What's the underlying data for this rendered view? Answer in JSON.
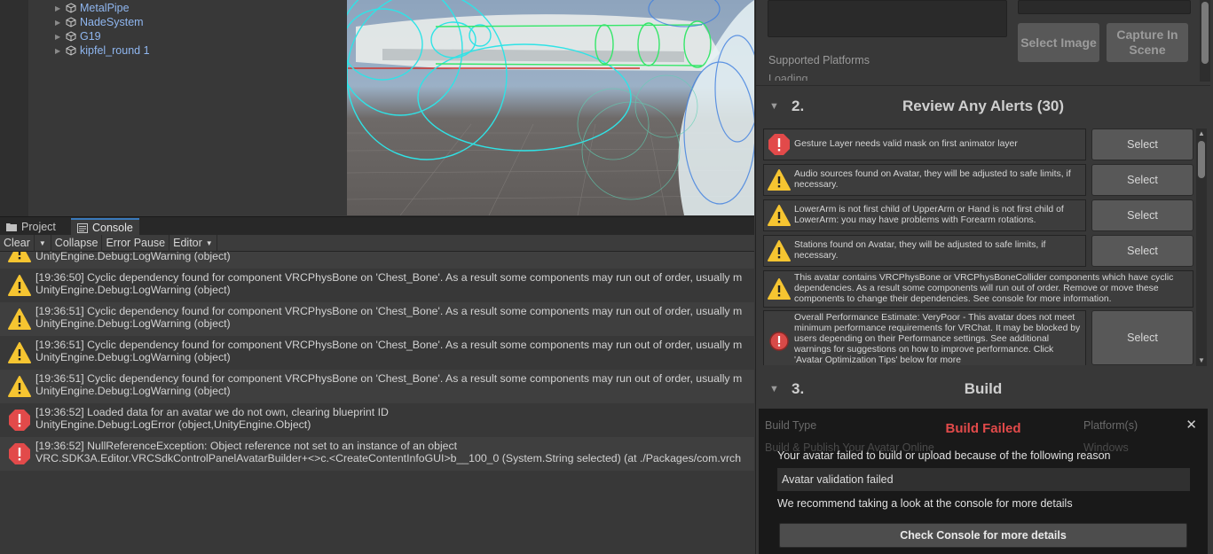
{
  "hierarchy": {
    "items": [
      {
        "label": "MetalPipe"
      },
      {
        "label": "NadeSystem"
      },
      {
        "label": "G19"
      },
      {
        "label": "kipfel_round 1"
      }
    ]
  },
  "console": {
    "tabs": [
      {
        "label": "Project",
        "icon": "folder-icon"
      },
      {
        "label": "Console",
        "icon": "console-icon"
      }
    ],
    "toolbar": {
      "clear": "Clear",
      "collapse": "Collapse",
      "error_pause": "Error Pause",
      "editor": "Editor"
    },
    "logs": [
      {
        "level": "warning",
        "line1": "UnityEngine.Debug:LogWarning (object)",
        "line2": ""
      },
      {
        "level": "warning",
        "line1": "[19:36:50] Cyclic dependency found for component VRCPhysBone on 'Chest_Bone'.  As a result some components may run out of order, usually m",
        "line2": "UnityEngine.Debug:LogWarning (object)"
      },
      {
        "level": "warning",
        "line1": "[19:36:51] Cyclic dependency found for component VRCPhysBone on 'Chest_Bone'.  As a result some components may run out of order, usually m",
        "line2": "UnityEngine.Debug:LogWarning (object)"
      },
      {
        "level": "warning",
        "line1": "[19:36:51] Cyclic dependency found for component VRCPhysBone on 'Chest_Bone'.  As a result some components may run out of order, usually m",
        "line2": "UnityEngine.Debug:LogWarning (object)"
      },
      {
        "level": "warning",
        "line1": "[19:36:51] Cyclic dependency found for component VRCPhysBone on 'Chest_Bone'.  As a result some components may run out of order, usually m",
        "line2": "UnityEngine.Debug:LogWarning (object)"
      },
      {
        "level": "error",
        "line1": "[19:36:52] Loaded data for an avatar we do not own, clearing blueprint ID",
        "line2": "UnityEngine.Debug:LogError (object,UnityEngine.Object)"
      },
      {
        "level": "error",
        "line1": "[19:36:52] NullReferenceException: Object reference not set to an instance of an object",
        "line2": "VRC.SDK3A.Editor.VRCSdkControlPanelAvatarBuilder+<>c.<CreateContentInfoGUI>b__100_0 (System.String selected) (at ./Packages/com.vrch"
      }
    ]
  },
  "sdk": {
    "select_image": "Select Image",
    "capture_in_scene": "Capture In Scene",
    "supported_platforms": "Supported Platforms",
    "loading": "Loading...",
    "section2": {
      "num": "2.",
      "title": "Review Any Alerts (30)"
    },
    "alerts": [
      {
        "level": "error",
        "message": "Gesture Layer needs valid mask on first animator layer",
        "select": "Select"
      },
      {
        "level": "warning",
        "message": "Audio sources found on Avatar, they will be adjusted to safe limits, if necessary.",
        "select": "Select"
      },
      {
        "level": "warning",
        "message": "LowerArm is not first child of UpperArm or Hand is not first child of LowerArm: you may have problems with Forearm rotations.",
        "select": "Select"
      },
      {
        "level": "warning",
        "message": "Stations found on Avatar, they will be adjusted to safe limits, if necessary.",
        "select": "Select"
      },
      {
        "level": "warning",
        "message": "This avatar contains VRCPhysBone or VRCPhysBoneCollider components which have cyclic dependencies.  As a result some components will run out of order.  Remove or move these components to change their dependencies.  See console for more information.",
        "select": ""
      },
      {
        "level": "perf-error",
        "message": "Overall Performance Estimate: VeryPoor - This avatar does not meet minimum performance requirements for VRChat. It may be blocked by users depending on their Performance settings. See additional warnings for suggestions on how to improve performance. Click 'Avatar Optimization Tips' below for more",
        "select": "Select"
      }
    ],
    "section3": {
      "num": "3.",
      "title": "Build"
    },
    "build_type_label": "Build Type",
    "platform_label": "Platform(s)",
    "build_type_value": "Build & Publish Your Avatar Online",
    "platform_value": "Windows"
  },
  "dialog": {
    "title": "Build Failed",
    "close": "✕",
    "reason": "Your avatar failed to build or upload because of the following reason",
    "field": "Avatar validation failed",
    "recommend": "We recommend taking a look at the console for more details",
    "button": "Check Console for more details"
  },
  "colors": {
    "accent_tab": "#3a79bb",
    "error_red": "#e24a4a",
    "warning_yellow": "#f6c531",
    "hierarchy_link": "#8fb6ef"
  }
}
